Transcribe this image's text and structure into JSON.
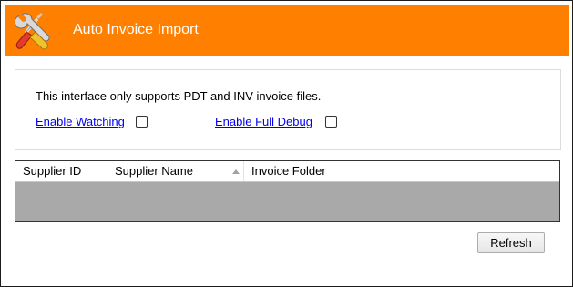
{
  "header": {
    "title": "Auto Invoice Import",
    "icon": "tools-icon",
    "background_color": "#ff8000"
  },
  "options_panel": {
    "info_text": "This interface only supports PDT and INV invoice files.",
    "enable_watching": {
      "label": "Enable Watching",
      "checked": false
    },
    "enable_full_debug": {
      "label": "Enable Full Debug",
      "checked": false
    }
  },
  "grid": {
    "columns": [
      "Supplier ID",
      "Supplier Name",
      "Invoice Folder"
    ],
    "sorted_column": "Supplier Name",
    "rows": []
  },
  "actions": {
    "refresh_label": "Refresh"
  }
}
